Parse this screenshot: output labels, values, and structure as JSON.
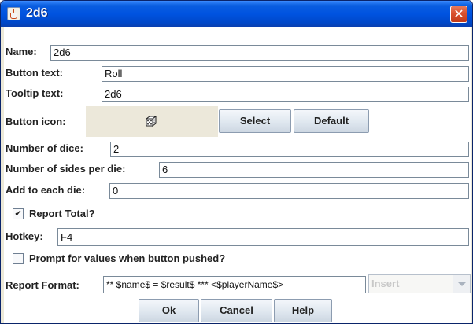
{
  "window": {
    "title": "2d6",
    "close_glyph": "✕"
  },
  "form": {
    "name": {
      "label": "Name:",
      "value": "2d6"
    },
    "button_text": {
      "label": "Button text:",
      "value": "Roll"
    },
    "tooltip_text": {
      "label": "Tooltip text:",
      "value": "2d6"
    },
    "button_icon": {
      "label": "Button icon:",
      "icon": "dice-icon",
      "select_label": "Select",
      "default_label": "Default"
    },
    "number_of_dice": {
      "label": "Number of dice:",
      "value": "2"
    },
    "sides_per_die": {
      "label": "Number of sides per die:",
      "value": "6"
    },
    "add_to_each_die": {
      "label": "Add to each die:",
      "value": "0"
    },
    "report_total": {
      "label": "Report Total?",
      "checked": true,
      "check_glyph": "✔"
    },
    "hotkey": {
      "label": "Hotkey:",
      "value": "F4"
    },
    "prompt_values": {
      "label": "Prompt for values when button pushed?",
      "checked": false
    },
    "report_format": {
      "label": "Report Format:",
      "value": "** $name$ = $result$ *** <$playerName$>",
      "insert_label": "Insert"
    }
  },
  "footer": {
    "ok_label": "Ok",
    "cancel_label": "Cancel",
    "help_label": "Help"
  }
}
